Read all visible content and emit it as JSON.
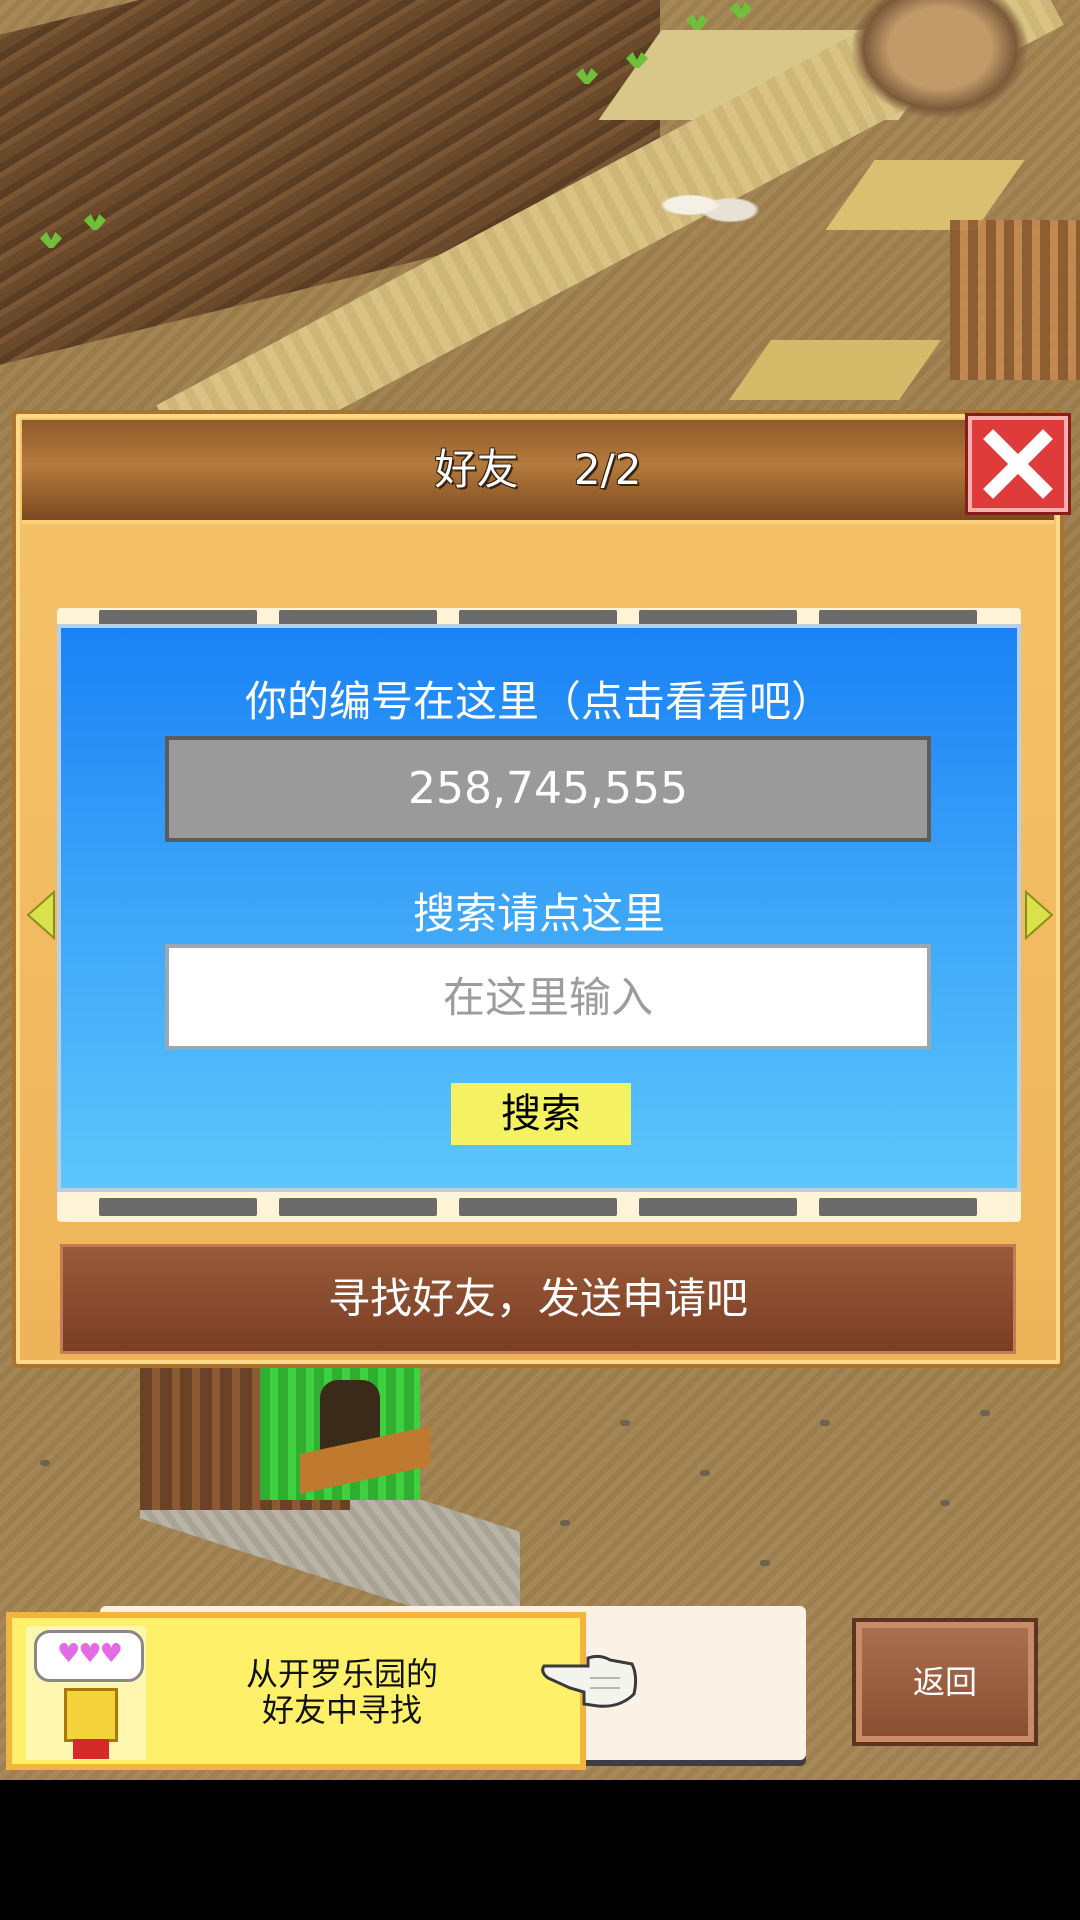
{
  "dialog": {
    "title": "好友　 2/2",
    "close_icon": "close-x-icon",
    "accent_colors": {
      "close": "#e03b3b",
      "panel": "#1a82f5",
      "button": "#f4f262"
    }
  },
  "id_section": {
    "label": "你的编号在这里（点击看看吧）",
    "value": "258,745,555"
  },
  "search_section": {
    "label": "搜索请点这里",
    "placeholder": "在这里输入",
    "button_label": "搜索"
  },
  "request_bar": {
    "label": "寻找好友，发送申请吧"
  },
  "hint": {
    "bubble": "♥♥♥",
    "text_line1": "从开罗乐园的",
    "text_line2": "好友中寻找"
  },
  "back_button": {
    "label": "返回"
  },
  "nav": {
    "left_icon": "arrow-left-icon",
    "right_icon": "arrow-right-icon"
  }
}
